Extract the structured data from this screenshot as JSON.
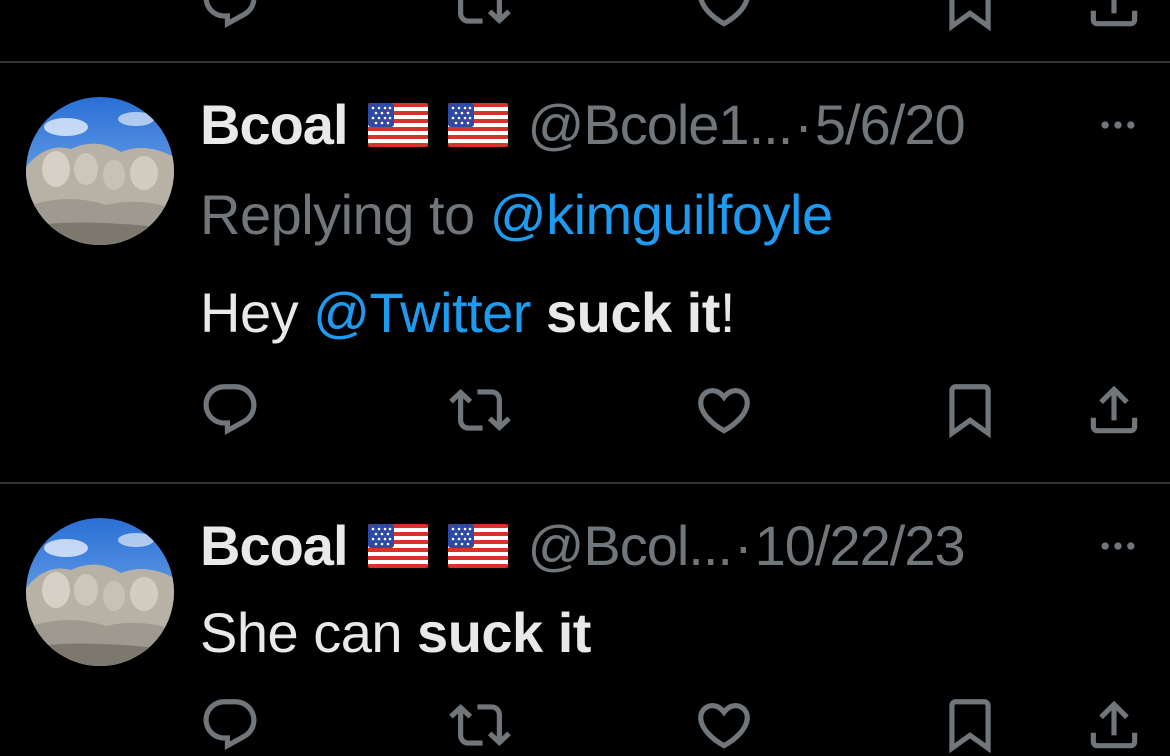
{
  "colors": {
    "background": "#000000",
    "primary_text": "#e7e9ea",
    "secondary_text": "#71767b",
    "link": "#1d9bf0",
    "divider": "#2f3336"
  },
  "icons": {
    "actions": [
      "reply-icon",
      "retweet-icon",
      "like-icon",
      "bookmark-icon",
      "share-icon"
    ],
    "more": "more-icon",
    "flag": "us-flag-emoji"
  },
  "tweets": [
    {
      "display_name": "Bcoal",
      "handle": "@Bcole1...",
      "separator": "·",
      "date": "5/6/20",
      "replying_prefix": "Replying to ",
      "replying_mention": "@kimguilfoyle",
      "body": {
        "part1": "Hey ",
        "mention": "@Twitter",
        "part2": " ",
        "bold1": "suck it",
        "part3": "!"
      }
    },
    {
      "display_name": "Bcoal",
      "handle": "@Bcol...",
      "separator": "·",
      "date": "10/22/23",
      "body": {
        "part1": "She can ",
        "bold1": "suck it"
      }
    }
  ]
}
